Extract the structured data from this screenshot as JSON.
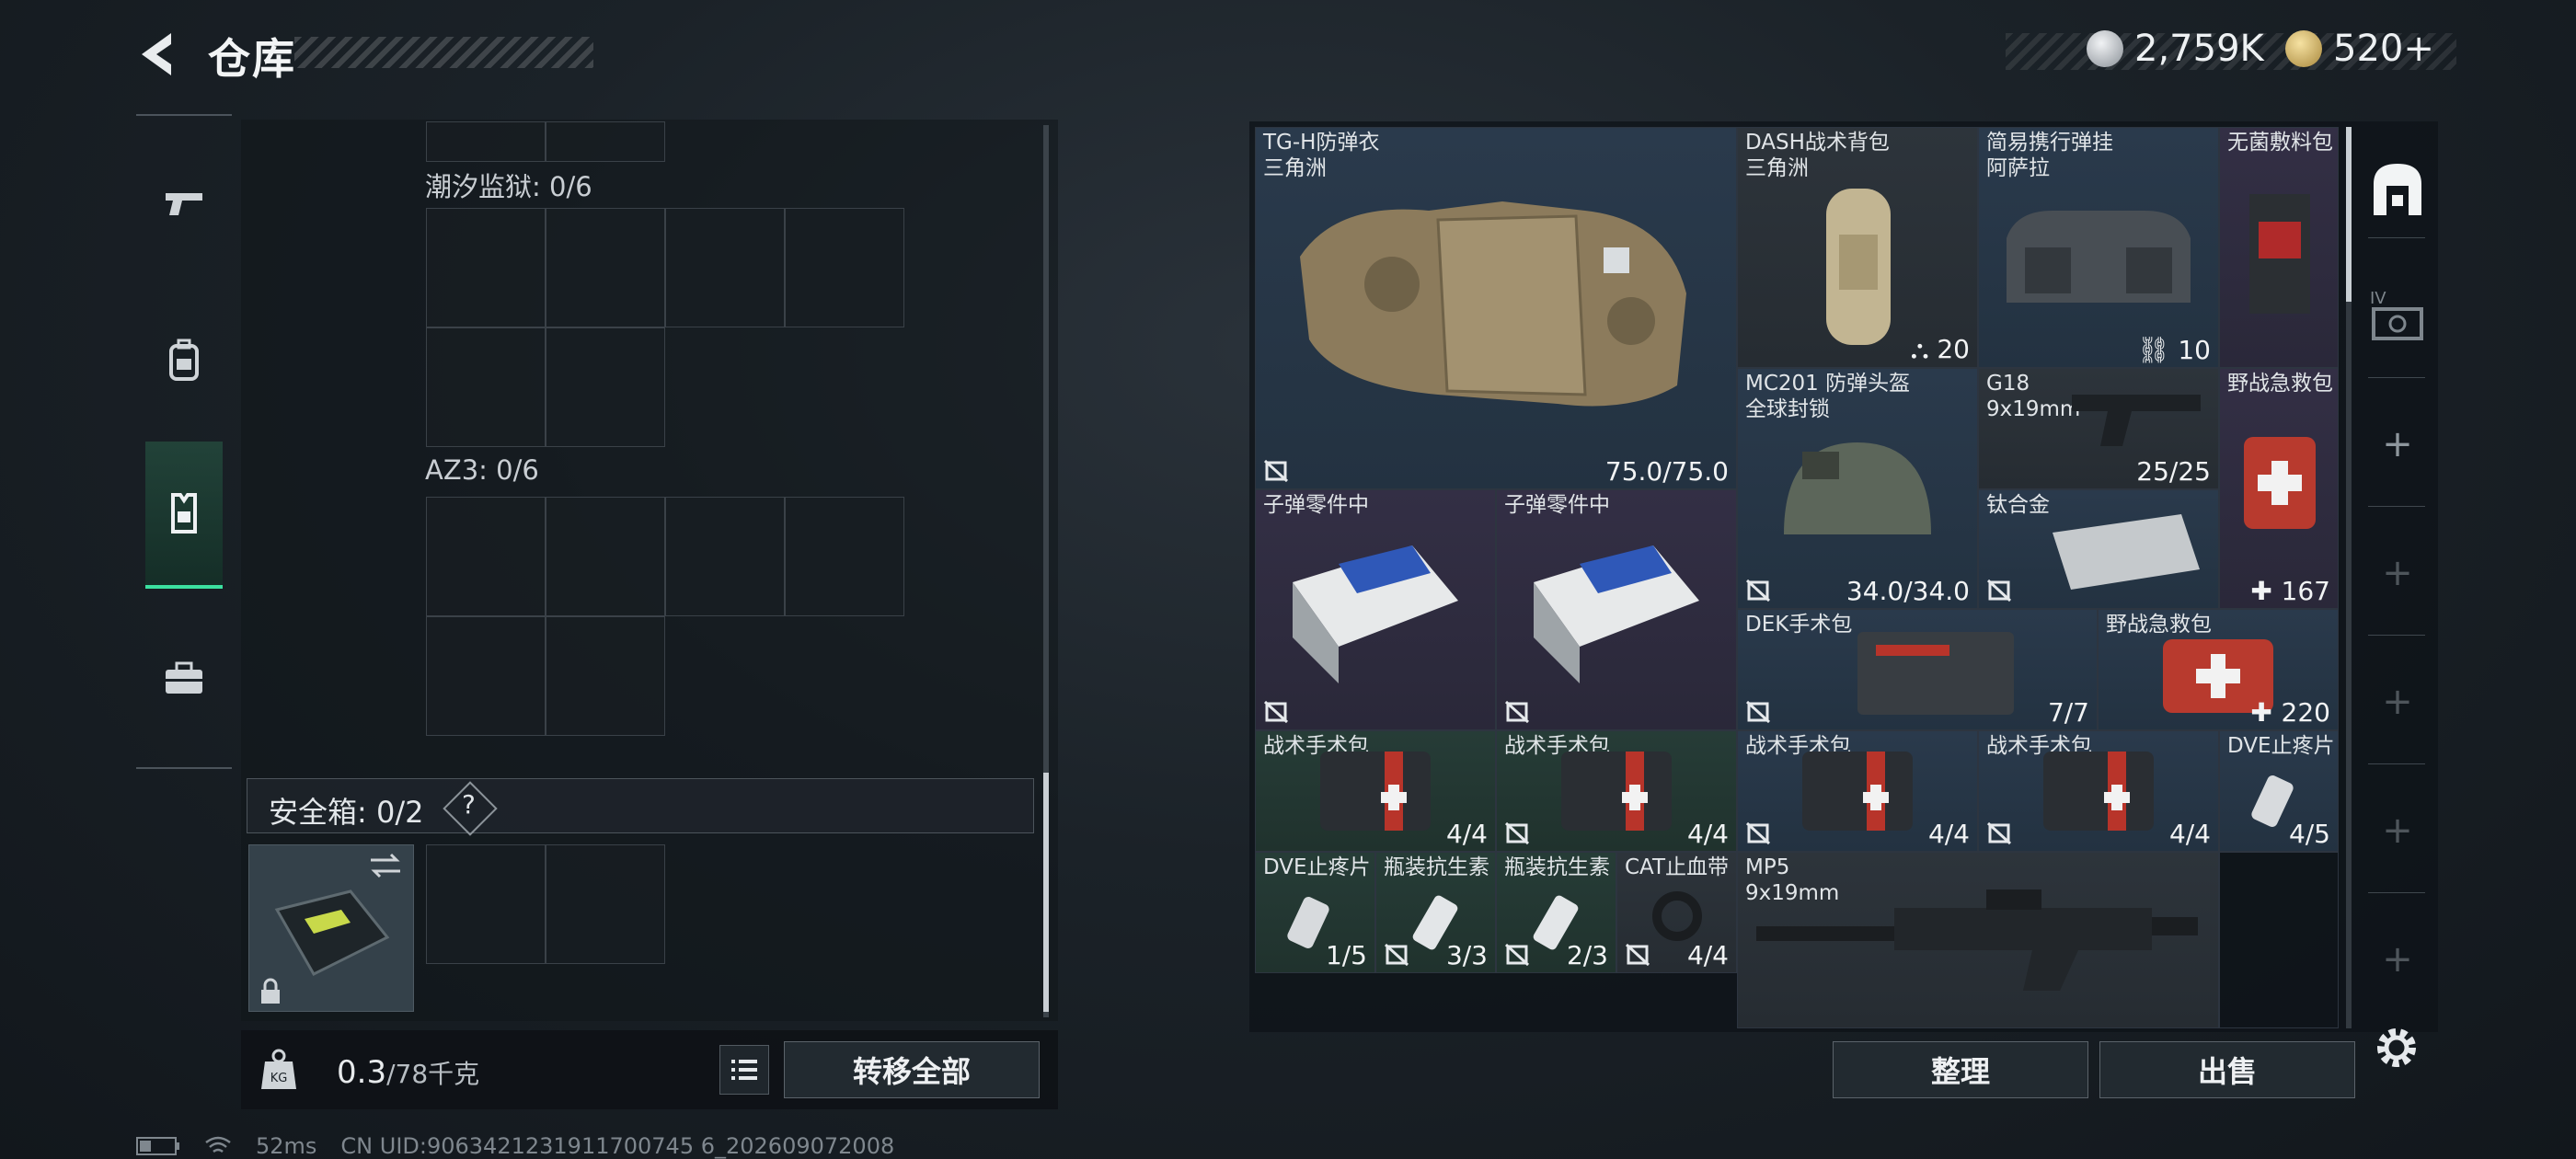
{
  "header": {
    "title": "仓库",
    "currency": [
      {
        "name": "silver-coin",
        "value": "2,759K",
        "color": "#c9cdd1"
      },
      {
        "name": "gold-coin",
        "value": "520+",
        "color": "#d4b060"
      }
    ]
  },
  "nav": {
    "items": [
      "pistol-icon",
      "backpack-icon",
      "vest-icon",
      "briefcase-icon"
    ],
    "active": 2,
    "accent": "#3be0a0"
  },
  "left": {
    "sections": [
      {
        "label": "潮汐监狱: 0/6"
      },
      {
        "label": "AZ3: 0/6"
      }
    ],
    "safe_box": {
      "label": "安全箱: 0/2",
      "help": "?"
    },
    "weight": {
      "current": "0.3",
      "max": "/78千克"
    },
    "transfer_all": "转移全部"
  },
  "status": {
    "ping": "52ms",
    "uid": "CN UID:9063421231911700745 6_202609072008"
  },
  "items": [
    {
      "name": "TG-H防弹衣",
      "sub": "三角洲",
      "qty": "75.0/75.0",
      "rarity": "blue"
    },
    {
      "name": "DASH战术背包",
      "sub": "三角洲",
      "qty": "20",
      "rarity": "gray"
    },
    {
      "name": "简易携行弹挂",
      "sub": "阿萨拉",
      "qty": "10",
      "rarity": "blue"
    },
    {
      "name": "无菌敷料包",
      "sub": "",
      "qty": "",
      "rarity": "purple"
    },
    {
      "name": "MC201 防弹头盔",
      "sub": "全球封锁",
      "qty": "34.0/34.0",
      "rarity": "blue"
    },
    {
      "name": "G18",
      "sub": "9x19mm",
      "qty": "25/25",
      "rarity": "gray"
    },
    {
      "name": "野战急救包",
      "sub": "",
      "qty": "167",
      "rarity": "purple"
    },
    {
      "name": "子弹零件中",
      "sub": "",
      "qty": "",
      "rarity": "purple"
    },
    {
      "name": "子弹零件中",
      "sub": "",
      "qty": "",
      "rarity": "purple"
    },
    {
      "name": "钛合金",
      "sub": "",
      "qty": "",
      "rarity": "blue"
    },
    {
      "name": "DEK手术包",
      "sub": "",
      "qty": "7/7",
      "rarity": "blue"
    },
    {
      "name": "野战急救包",
      "sub": "",
      "qty": "220",
      "rarity": "blue"
    },
    {
      "name": "战术手术包",
      "sub": "",
      "qty": "4/4",
      "rarity": "green"
    },
    {
      "name": "战术手术包",
      "sub": "",
      "qty": "4/4",
      "rarity": "green"
    },
    {
      "name": "战术手术包",
      "sub": "",
      "qty": "4/4",
      "rarity": "blue"
    },
    {
      "name": "战术手术包",
      "sub": "",
      "qty": "4/4",
      "rarity": "blue"
    },
    {
      "name": "DVE止疼片",
      "sub": "",
      "qty": "4/5",
      "rarity": "blue"
    },
    {
      "name": "DVE止疼片",
      "sub": "",
      "qty": "1/5",
      "rarity": "green"
    },
    {
      "name": "瓶装抗生素",
      "sub": "",
      "qty": "3/3",
      "rarity": "green"
    },
    {
      "name": "瓶装抗生素",
      "sub": "",
      "qty": "2/3",
      "rarity": "green"
    },
    {
      "name": "CAT止血带",
      "sub": "",
      "qty": "4/4",
      "rarity": "gray"
    },
    {
      "name": "MP5",
      "sub": "9x19mm",
      "qty": "",
      "rarity": "gray"
    }
  ],
  "actions": {
    "tidy": "整理",
    "sell": "出售"
  }
}
